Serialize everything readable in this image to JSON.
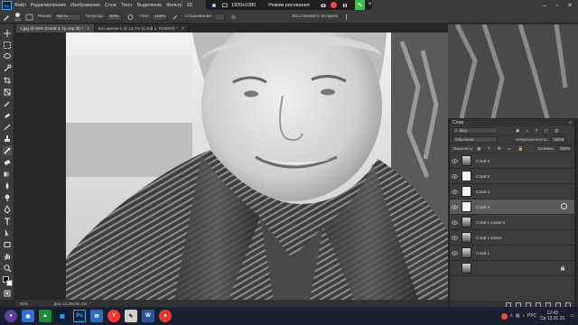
{
  "menubar": {
    "items": [
      "Файл",
      "Редактирование",
      "Изображение",
      "Слои",
      "Текст",
      "Выделение",
      "Фильтр",
      "3D"
    ]
  },
  "recorder": {
    "resolution": "1920x1080",
    "mode": "Режим рисования"
  },
  "options": {
    "brush_size": "125",
    "mode_label": "Режим:",
    "mode_value": "Кисть",
    "opacity_label": "Непрозр.:",
    "opacity_value": "50%",
    "flow_label": "Наж.:",
    "flow_value": "100%",
    "smoothing_label": "Сглаживание:",
    "history_label": "Восстановить историю"
  },
  "tabs": [
    {
      "label": "1.jpg @ 50% (Слой 4, Гр.сер./8) *",
      "active": true
    },
    {
      "label": "Без имени-1 @ 16,7% (Слой 1, RGB/8#) *",
      "active": false
    }
  ],
  "statusbar": {
    "zoom": "50%",
    "doc": "Док: 12,0М/86,1М"
  },
  "layers_panel": {
    "title": "Слои",
    "kind_label": "Вид",
    "blend_mode": "Обычные",
    "opacity_label": "Непрозрачность:",
    "opacity_value": "100%",
    "lock_label": "Закрепить:",
    "fill_label": "Заливка:",
    "fill_value": "100%",
    "layers": [
      {
        "name": "Слой 6",
        "visible": true,
        "thumb": "photo",
        "active": false,
        "locked": false
      },
      {
        "name": "Слой 5",
        "visible": true,
        "thumb": "white",
        "active": false,
        "locked": false
      },
      {
        "name": "Слой 2",
        "visible": true,
        "thumb": "white",
        "active": false,
        "locked": false
      },
      {
        "name": "Слой 4",
        "visible": true,
        "thumb": "white",
        "active": true,
        "locked": false
      },
      {
        "name": "Слой 1 копия 2",
        "visible": true,
        "thumb": "photo",
        "active": false,
        "locked": false
      },
      {
        "name": "Слой 1 копия",
        "visible": true,
        "thumb": "photo",
        "active": false,
        "locked": false
      },
      {
        "name": "Слой 1",
        "visible": true,
        "thumb": "photo",
        "active": false,
        "locked": false
      },
      {
        "name": "",
        "visible": false,
        "thumb": "photo",
        "active": false,
        "locked": true
      }
    ]
  },
  "taskbar": {
    "lang": "РУС",
    "time": "12:43",
    "date": "Ср 13.01.21"
  }
}
